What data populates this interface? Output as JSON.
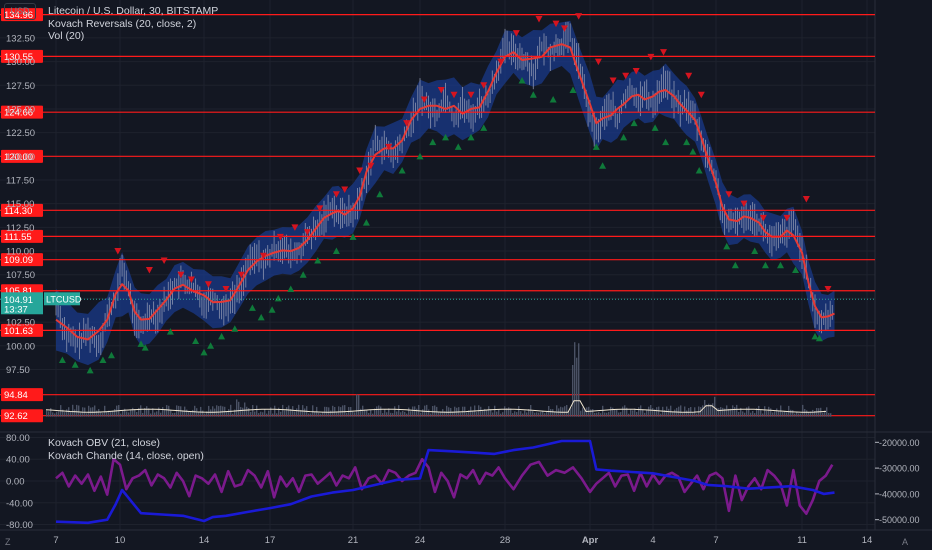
{
  "header": {
    "symbol_title": "Litecoin / U.S. Dollar, 30, BITSTAMP",
    "indicator_1": "Kovach Reversals (20, close, 2)",
    "indicator_2": "Vol (20)",
    "lower_indicator_1": "Kovach OBV (21, close)",
    "lower_indicator_2": "Kovach Chande (14, close, open)"
  },
  "controls": {
    "currency": "USD",
    "zoom": "Z",
    "auto": "A"
  },
  "colors": {
    "background": "#131722",
    "grid": "#1e222d",
    "level_line": "#ff1a1a",
    "price_line": "#e53935",
    "band": "#1a3a8a",
    "candle": "#9aa0b8",
    "arrow_up": "#0f7a3a",
    "arrow_down": "#d5141f",
    "last_price": "#26a69a",
    "obv": "#1a1ad6",
    "chande": "#7b1a8c",
    "axis_text": "#b2b5be"
  },
  "chart_data": [
    {
      "type": "line",
      "title": "Litecoin / U.S. Dollar, 30, BITSTAMP",
      "x_ticks": [
        "7",
        "10",
        "14",
        "17",
        "21",
        "24",
        "28",
        "Apr",
        "4",
        "7",
        "11",
        "14"
      ],
      "y_ticks": [
        97.5,
        100.0,
        102.5,
        105.0,
        107.5,
        110.0,
        112.5,
        115.0,
        117.5,
        120.0,
        122.5,
        125.0,
        127.5,
        130.0,
        132.5
      ],
      "y_tick_labels": [
        "97.50",
        "100.00",
        "102.50",
        "105.00",
        "107.50",
        "110.00",
        "112.50",
        "115.00",
        "117.50",
        "120.00",
        "122.50",
        "125.00",
        "127.50",
        "130.00",
        "132.50"
      ],
      "ylim": [
        90.9,
        136.5
      ],
      "levels": [
        134.96,
        130.55,
        124.66,
        120.0,
        114.3,
        111.55,
        109.09,
        105.81,
        101.63,
        94.84,
        92.62
      ],
      "level_labels": [
        "134.96",
        "130.55",
        "124.66",
        "120.00",
        "114.30",
        "111.55",
        "109.09",
        "105.81",
        "101.63",
        "94.84",
        "92.62"
      ],
      "last_price": {
        "value": 104.91,
        "label": "104.91",
        "countdown": "13:37",
        "symbol": "LTCUSD"
      },
      "price_series": {
        "x": [
          7.0,
          7.5,
          8.0,
          8.5,
          9.0,
          9.4,
          9.8,
          10.1,
          10.4,
          10.7,
          11.0,
          11.4,
          11.8,
          12.2,
          12.6,
          13.0,
          13.5,
          14.0,
          14.4,
          14.8,
          15.2,
          15.6,
          16.0,
          16.4,
          16.8,
          17.2,
          17.6,
          18.0,
          18.4,
          18.8,
          19.2,
          19.6,
          20.0,
          20.3,
          20.6,
          21.0,
          21.3,
          21.6,
          22.0,
          22.4,
          22.8,
          23.2,
          23.6,
          24.0,
          24.4,
          24.8,
          25.2,
          25.6,
          26.0,
          26.4,
          26.8,
          27.2,
          27.6,
          28.0,
          28.3,
          28.6,
          29.0,
          29.3,
          29.6,
          30.0,
          30.3,
          30.6,
          31.0,
          31.3,
          31.6,
          32.0,
          32.3,
          32.6,
          33.0,
          33.3,
          33.6,
          34.0,
          34.3,
          34.6,
          35.0,
          35.3,
          35.6,
          36.0,
          36.3,
          36.6,
          37.0,
          37.3,
          37.6,
          38.0,
          38.3,
          38.6,
          39.0,
          39.3,
          39.6,
          40.0,
          40.3,
          40.6,
          41.0,
          41.3,
          41.6,
          41.9,
          42.2,
          42.5
        ],
        "y": [
          104.5,
          101.0,
          100.3,
          101.5,
          100.2,
          103.0,
          105.0,
          108.5,
          106.0,
          103.0,
          101.8,
          103.5,
          103.2,
          104.8,
          106.5,
          106.8,
          106.0,
          104.5,
          105.5,
          103.8,
          104.6,
          106.0,
          108.5,
          109.5,
          108.8,
          110.2,
          110.5,
          109.5,
          110.0,
          111.5,
          112.0,
          113.5,
          115.0,
          113.5,
          114.2,
          113.8,
          115.5,
          118.0,
          121.5,
          121.0,
          120.0,
          121.5,
          123.5,
          126.5,
          125.0,
          124.5,
          126.5,
          124.0,
          125.5,
          124.0,
          125.5,
          126.0,
          129.0,
          131.5,
          131.0,
          130.5,
          129.0,
          131.5,
          131.0,
          132.0,
          132.5,
          130.0,
          124.0,
          122.5,
          124.0,
          125.5,
          123.5,
          126.0,
          127.0,
          126.0,
          126.5,
          125.5,
          127.0,
          128.0,
          126.0,
          125.0,
          125.5,
          124.0,
          122.0,
          120.0,
          117.5,
          114.0,
          112.5,
          113.5,
          113.5,
          114.0,
          113.0,
          112.0,
          111.0,
          111.5,
          112.0,
          113.0,
          110.0,
          106.5,
          103.5,
          102.5,
          103.0,
          103.8
        ]
      },
      "reversal_arrows": {
        "up_x": [
          7.3,
          7.9,
          8.6,
          9.2,
          9.6,
          11.0,
          11.2,
          12.4,
          13.6,
          14.0,
          14.3,
          14.8,
          15.4,
          16.2,
          16.6,
          17.1,
          17.4,
          18.0,
          18.6,
          19.3,
          20.2,
          21.0,
          21.6,
          22.2,
          23.2,
          24.0,
          24.6,
          25.2,
          25.8,
          26.4,
          27.0,
          28.6,
          29.0,
          29.7,
          30.4,
          31.3,
          31.6,
          32.6,
          33.1,
          34.1,
          34.6,
          35.6,
          35.9,
          36.2,
          37.5,
          37.9,
          38.8,
          39.3,
          40.0,
          40.7,
          41.6,
          41.8
        ],
        "up_y": [
          98.5,
          98.0,
          97.4,
          98.5,
          99.0,
          100.2,
          99.8,
          101.5,
          100.5,
          99.3,
          100.0,
          101.0,
          101.8,
          104.0,
          103.0,
          103.8,
          105.0,
          106.0,
          107.5,
          109.0,
          110.0,
          111.5,
          113.0,
          116.0,
          118.5,
          120.0,
          121.5,
          122.0,
          121.0,
          122.0,
          123.0,
          128.0,
          126.5,
          126.0,
          127.0,
          121.0,
          119.0,
          122.0,
          123.5,
          123.0,
          121.5,
          121.5,
          120.5,
          118.5,
          110.5,
          108.5,
          110.0,
          108.5,
          108.5,
          108.0,
          101.0,
          100.8
        ],
        "down_x": [
          9.9,
          11.4,
          12.1,
          12.9,
          13.4,
          14.2,
          15.0,
          15.7,
          16.7,
          17.5,
          18.2,
          18.8,
          19.4,
          20.2,
          20.6,
          21.3,
          21.8,
          22.6,
          23.4,
          24.2,
          25.0,
          25.6,
          26.4,
          27.0,
          27.8,
          28.4,
          29.2,
          29.8,
          30.1,
          30.6,
          31.4,
          32.1,
          32.7,
          33.2,
          33.9,
          34.5,
          35.7,
          36.3,
          37.6,
          38.3,
          39.2,
          40.3,
          41.2,
          42.2
        ],
        "down_y": [
          110.0,
          108.0,
          109.0,
          107.5,
          107.0,
          106.5,
          106.0,
          107.5,
          109.5,
          111.5,
          112.5,
          112.0,
          114.5,
          116.0,
          116.5,
          118.5,
          119.0,
          121.0,
          123.5,
          126.0,
          127.0,
          126.5,
          126.5,
          127.5,
          130.0,
          133.0,
          134.5,
          134.0,
          133.5,
          134.8,
          130.0,
          128.0,
          128.5,
          129.0,
          130.5,
          131.0,
          128.5,
          126.5,
          116.0,
          115.0,
          113.5,
          113.5,
          115.5,
          106.0
        ]
      }
    },
    {
      "type": "bar",
      "title": "Vol (20)",
      "note": "volume histogram under price pane"
    },
    {
      "type": "line",
      "title": "Kovach OBV / Kovach Chande",
      "left_y_ticks": [
        "80.00",
        "40.00",
        "0.00",
        "-40.00",
        "-80.00"
      ],
      "left_ylim": [
        -90,
        90
      ],
      "right_y_ticks": [
        "-20000.00",
        "-30000.00",
        "-40000.00",
        "-50000.00"
      ],
      "right_ylim": [
        -54000,
        -16000
      ],
      "series": [
        {
          "name": "Kovach OBV (21, close)",
          "axis": "right",
          "x": [
            7.0,
            8.5,
            9.4,
            9.8,
            10.1,
            11.0,
            12.0,
            13.0,
            14.0,
            14.4,
            15.0,
            16.0,
            17.0,
            18.0,
            19.0,
            20.0,
            21.0,
            22.0,
            23.0,
            24.0,
            24.4,
            25.5,
            26.5,
            27.5,
            28.3,
            29.0,
            30.0,
            31.0,
            31.3,
            32.0,
            33.0,
            34.0,
            35.0,
            36.0,
            36.6,
            37.5,
            38.5,
            39.5,
            40.5,
            41.5,
            42.0,
            42.5
          ],
          "y": [
            -50800,
            -51200,
            -50000,
            -44000,
            -38500,
            -47500,
            -48000,
            -48500,
            -50500,
            -49000,
            -48500,
            -47000,
            -45500,
            -44000,
            -41000,
            -39500,
            -38500,
            -36500,
            -34500,
            -34000,
            -23000,
            -23500,
            -24000,
            -24500,
            -23000,
            -22000,
            -19500,
            -19500,
            -30500,
            -31000,
            -31500,
            -32000,
            -33500,
            -35000,
            -36500,
            -37000,
            -38000,
            -37500,
            -37000,
            -38500,
            -40000,
            -39500
          ]
        },
        {
          "name": "Kovach Chande (14, close, open)",
          "axis": "left",
          "x": [
            7.0,
            7.3,
            7.6,
            7.9,
            8.2,
            8.5,
            8.8,
            9.1,
            9.4,
            9.7,
            10.0,
            10.3,
            10.6,
            10.9,
            11.2,
            11.5,
            11.8,
            12.1,
            12.4,
            12.7,
            13.0,
            13.3,
            13.6,
            13.9,
            14.2,
            14.5,
            14.8,
            15.1,
            15.4,
            15.7,
            16.0,
            16.3,
            16.6,
            16.9,
            17.2,
            17.5,
            17.8,
            18.1,
            18.4,
            18.7,
            19.0,
            19.3,
            19.6,
            19.9,
            20.2,
            20.5,
            20.8,
            21.1,
            21.4,
            21.7,
            22.0,
            22.3,
            22.6,
            22.9,
            23.2,
            23.5,
            23.8,
            24.1,
            24.4,
            24.7,
            25.0,
            25.3,
            25.6,
            25.9,
            26.2,
            26.5,
            26.8,
            27.1,
            27.4,
            27.7,
            28.0,
            28.3,
            28.6,
            28.9,
            29.2,
            29.5,
            29.8,
            30.1,
            30.4,
            30.7,
            31.0,
            31.3,
            31.6,
            31.9,
            32.2,
            32.5,
            32.8,
            33.1,
            33.4,
            33.7,
            34.0,
            34.3,
            34.6,
            34.9,
            35.2,
            35.5,
            35.8,
            36.1,
            36.4,
            36.7,
            37.0,
            37.3,
            37.6,
            37.9,
            38.2,
            38.5,
            38.8,
            39.1,
            39.4,
            39.7,
            40.0,
            40.3,
            40.6,
            40.9,
            41.2,
            41.5,
            41.8,
            42.1,
            42.4
          ],
          "y": [
            5,
            15,
            -10,
            10,
            -5,
            12,
            -18,
            8,
            -25,
            40,
            30,
            -15,
            5,
            10,
            20,
            -8,
            12,
            5,
            -12,
            15,
            0,
            -28,
            10,
            5,
            -5,
            12,
            -20,
            18,
            -10,
            -6,
            20,
            10,
            -12,
            18,
            -30,
            8,
            -10,
            5,
            -20,
            10,
            12,
            -5,
            5,
            15,
            -8,
            10,
            5,
            25,
            -15,
            5,
            10,
            -5,
            20,
            15,
            0,
            10,
            15,
            40,
            25,
            -20,
            15,
            0,
            -30,
            12,
            5,
            20,
            -5,
            15,
            10,
            25,
            5,
            -15,
            10,
            30,
            35,
            10,
            20,
            15,
            25,
            5,
            -20,
            -5,
            5,
            15,
            -10,
            10,
            12,
            -18,
            15,
            -10,
            12,
            -5,
            10,
            15,
            8,
            -20,
            -5,
            10,
            -15,
            10,
            15,
            5,
            -55,
            10,
            -35,
            -10,
            5,
            -15,
            20,
            10,
            -5,
            -45,
            20,
            -45,
            -60,
            -35,
            0,
            10,
            30
          ]
        }
      ]
    }
  ]
}
